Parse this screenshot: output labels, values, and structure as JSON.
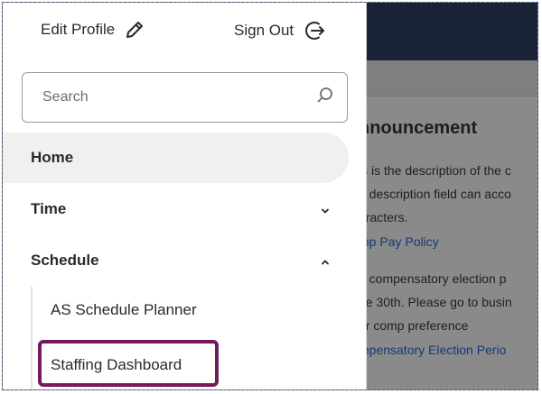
{
  "drawer": {
    "edit_profile": "Edit Profile",
    "sign_out": "Sign Out",
    "search_placeholder": "Search",
    "nav": [
      {
        "label": "Home"
      },
      {
        "label": "Time"
      },
      {
        "label": "Schedule"
      }
    ],
    "schedule_children": [
      {
        "label": "AS Schedule Planner"
      },
      {
        "label": "Staffing Dashboard"
      }
    ]
  },
  "background": {
    "title": "nnouncement",
    "lines": [
      "is is the description of the c",
      "e description field can acco",
      "aracters."
    ],
    "link1": "mp Pay Policy",
    "lines2": [
      "e compensatory election p",
      "ne 30th. Please go to busin",
      "ur comp preference"
    ],
    "link2": "mpensatory Election Perio"
  },
  "colors": {
    "header_bg": "#1a2236",
    "highlight": "#731b5a",
    "link": "#123a78"
  },
  "icons": {
    "edit": "pencil-icon",
    "sign_out": "sign-out-arrow-icon",
    "search": "search-icon",
    "time_chevron": "chevron-down-icon",
    "schedule_chevron": "chevron-up-icon"
  }
}
